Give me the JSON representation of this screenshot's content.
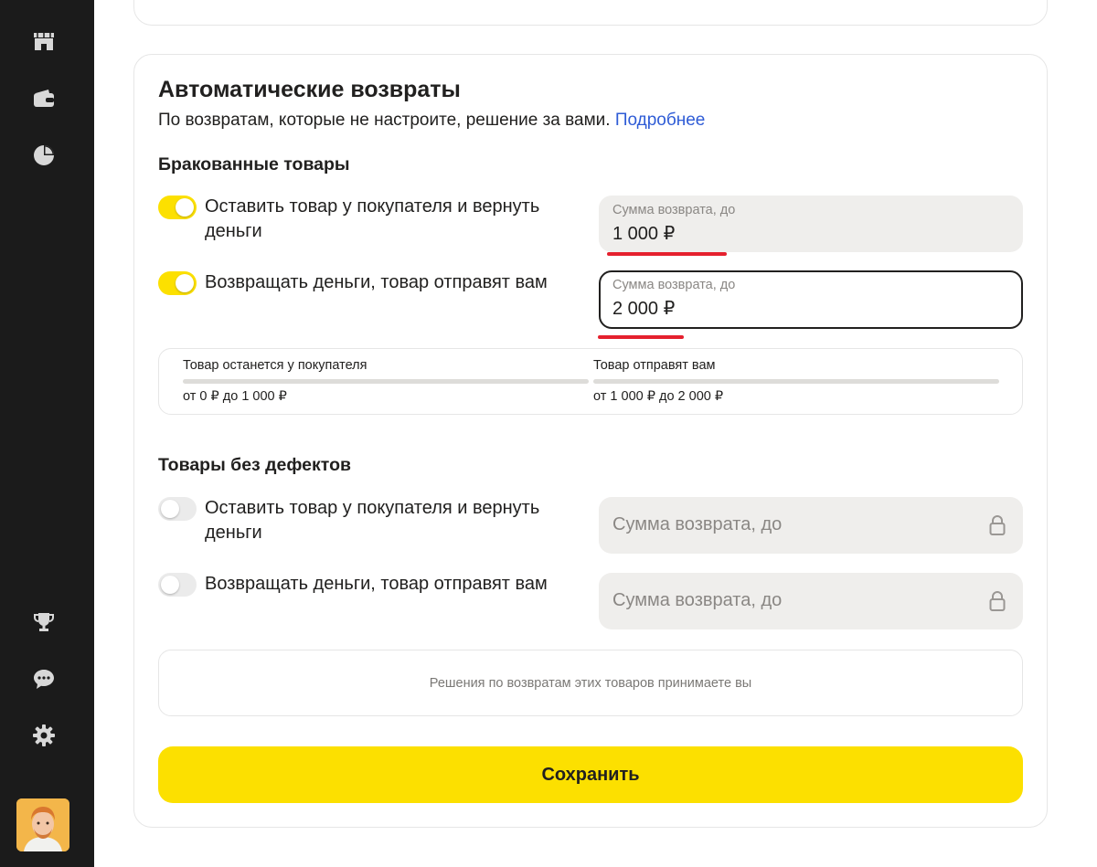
{
  "sidebar": {
    "icons": [
      "storefront-icon",
      "wallet-icon",
      "pie-chart-icon",
      "trophy-icon",
      "chat-icon",
      "gear-icon"
    ]
  },
  "card": {
    "title": "Автоматические возвраты",
    "subtitle": "По возвратам, которые не настроите, решение за вами.",
    "more_link": "Подробнее",
    "defective": {
      "heading": "Бракованные товары",
      "option1": {
        "label": "Оставить товар у покупателя и вернуть деньги",
        "enabled": true
      },
      "option2": {
        "label": "Возвращать деньги, товар отправят вам",
        "enabled": true
      },
      "field1": {
        "label": "Сумма возврата, до",
        "value": "1 000 ₽"
      },
      "field2": {
        "label": "Сумма возврата, до",
        "value": "2 000 ₽"
      },
      "ranges": [
        {
          "title": "Товар останется у покупателя",
          "value": "от 0 ₽ до  1 000 ₽"
        },
        {
          "title": "Товар отправят вам",
          "value": "от 1 000 ₽ до  2 000 ₽"
        }
      ]
    },
    "no_defects": {
      "heading": "Товары без дефектов",
      "option1": {
        "label": "Оставить товар у покупателя и вернуть деньги",
        "enabled": false
      },
      "option2": {
        "label": "Возвращать деньги, товар отправят вам",
        "enabled": false
      },
      "field1": {
        "placeholder": "Сумма возврата, до"
      },
      "field2": {
        "placeholder": "Сумма возврата, до"
      },
      "note": "Решения по возвратам этих товаров принимаете вы"
    },
    "save_label": "Сохранить"
  },
  "colors": {
    "accent": "#fce000",
    "link": "#2f5cd6",
    "underline": "#e5202e",
    "sidebar": "#1b1b1b"
  }
}
